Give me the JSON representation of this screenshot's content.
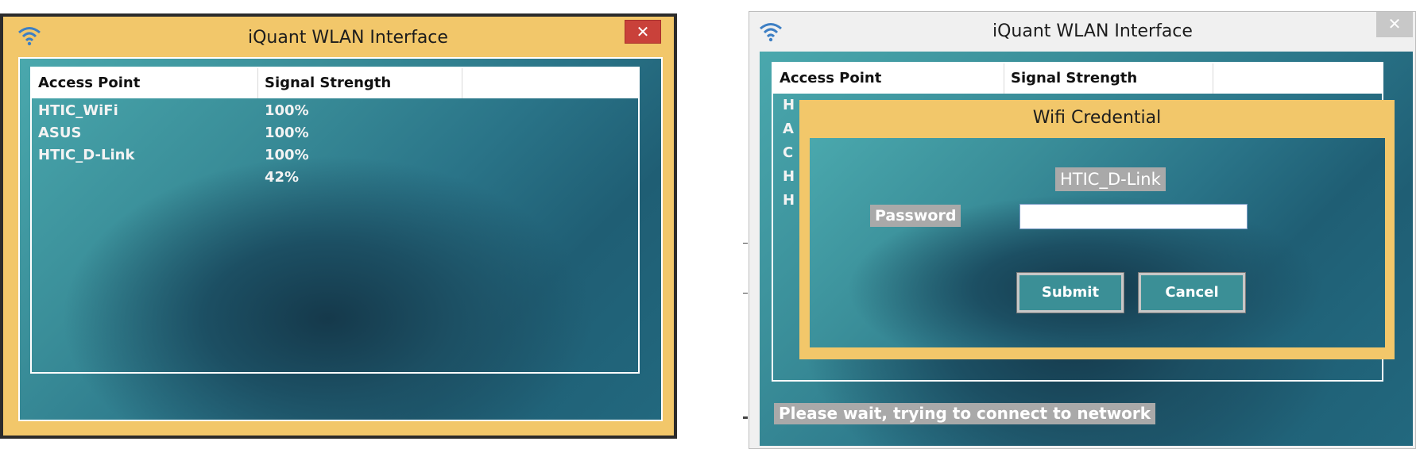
{
  "left_window": {
    "title": "iQuant WLAN Interface",
    "close_glyph": "✕",
    "icon": "wifi-icon",
    "list": {
      "columns": [
        "Access Point",
        "Signal Strength",
        ""
      ],
      "rows": [
        {
          "ap": "HTIC_WiFi",
          "signal": "100%"
        },
        {
          "ap": "ASUS",
          "signal": "100%"
        },
        {
          "ap": "HTIC_D-Link",
          "signal": "100%"
        },
        {
          "ap": "",
          "signal": "42%"
        }
      ]
    }
  },
  "right_window": {
    "title": "iQuant WLAN Interface",
    "close_glyph": "✕",
    "icon": "wifi-icon",
    "list": {
      "columns": [
        "Access Point",
        "Signal Strength",
        ""
      ],
      "row_initials": [
        "H",
        "A",
        "C",
        "H",
        "H"
      ]
    },
    "dialog": {
      "title": "Wifi Credential",
      "ssid": "HTIC_D-Link",
      "password_label": "Password",
      "password_value": "",
      "submit_label": "Submit",
      "cancel_label": "Cancel"
    },
    "status": "Please wait, trying to connect to network"
  },
  "colors": {
    "frame_gold": "#f2c76a",
    "teal_dark": "#15394b",
    "teal_light": "#4aa8ad",
    "close_red": "#c9413a",
    "label_gray": "#a9a9a9"
  }
}
